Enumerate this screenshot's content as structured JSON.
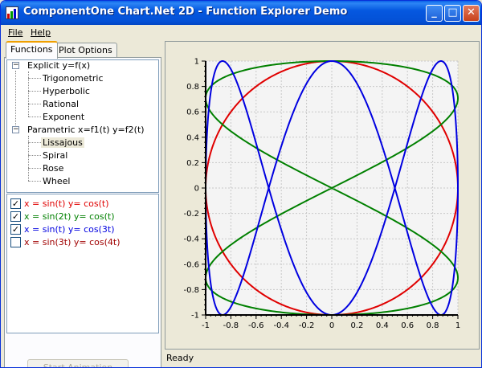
{
  "window": {
    "title": "ComponentOne Chart.Net 2D - Function Explorer Demo",
    "buttons": {
      "minimize": "_",
      "maximize": "□",
      "close": "✕"
    }
  },
  "menu": {
    "file": "File",
    "help": "Help"
  },
  "tabs": {
    "functions": "Functions",
    "plot_options": "Plot Options"
  },
  "tree": {
    "explicit": {
      "label": "Explicit y=f(x)",
      "children": [
        "Trigonometric",
        "Hyperbolic",
        "Rational",
        "Exponent"
      ]
    },
    "parametric": {
      "label": "Parametric x=f1(t) y=f2(t)",
      "children": [
        "Lissajous",
        "Spiral",
        "Rose",
        "Wheel"
      ],
      "selected": "Lissajous"
    }
  },
  "functions": [
    {
      "label": "x = sin(t) y= cos(t)",
      "checked": true,
      "color": "#e00000"
    },
    {
      "label": "x = sin(2t) y= cos(t)",
      "checked": true,
      "color": "#008000"
    },
    {
      "label": "x = sin(t) y= cos(3t)",
      "checked": true,
      "color": "#0000e0"
    },
    {
      "label": "x = sin(3t) y= cos(4t)",
      "checked": false,
      "color": "#a00000"
    }
  ],
  "start_animation": "Start Animation",
  "status": "Ready",
  "chart_data": {
    "type": "line",
    "title": "",
    "xlabel": "",
    "ylabel": "",
    "xlim": [
      -1,
      1
    ],
    "ylim": [
      -1,
      1
    ],
    "grid": true,
    "x_ticks": [
      "-1",
      "-0.8",
      "-0.6",
      "-0.4",
      "-0.2",
      "0",
      "0.2",
      "0.4",
      "0.6",
      "0.8",
      "1"
    ],
    "y_ticks": [
      "-1",
      "-0.8",
      "-0.6",
      "-0.4",
      "-0.2",
      "0",
      "0.2",
      "0.4",
      "0.6",
      "0.8",
      "1"
    ],
    "series": [
      {
        "x_expr": "sin(t)",
        "y_expr": "cos(t)",
        "color": "#e00000"
      },
      {
        "x_expr": "sin(2t)",
        "y_expr": "cos(t)",
        "color": "#008000"
      },
      {
        "x_expr": "sin(t)",
        "y_expr": "cos(3t)",
        "color": "#0000e0"
      }
    ]
  }
}
